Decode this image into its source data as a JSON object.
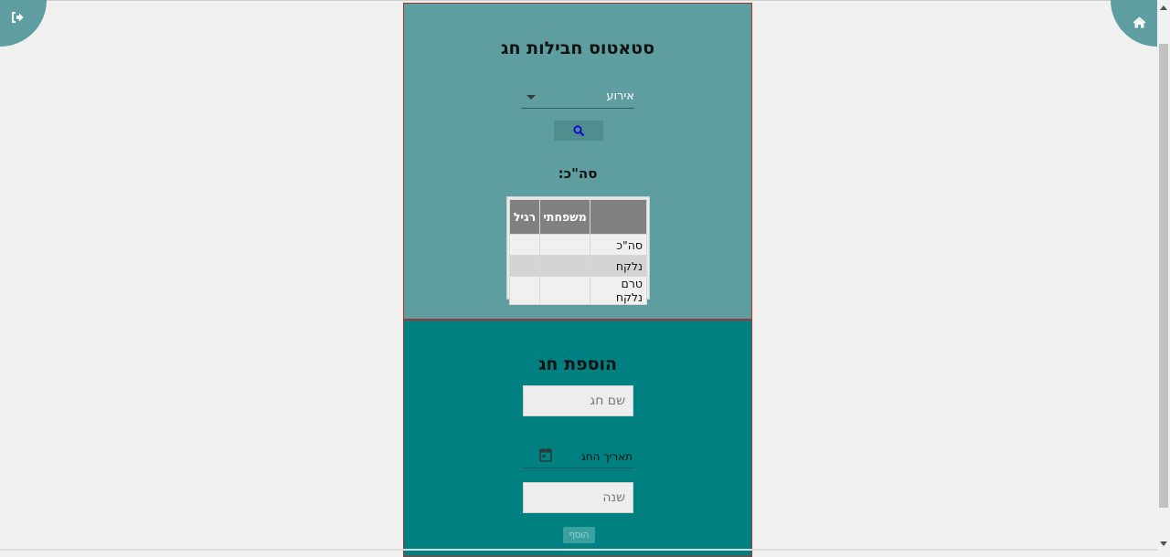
{
  "nav": {
    "logout_icon": "sign-out-icon",
    "home_icon": "home-icon"
  },
  "status_panel": {
    "title": "סטאטוס חבילות חג",
    "event_select": {
      "selected": "אירוע"
    },
    "search_icon": "search-icon",
    "total_label": "סה\"כ:",
    "table": {
      "headers": [
        "",
        "משפחתי",
        "רגיל"
      ],
      "rows": [
        {
          "label": "סה\"כ",
          "family": "",
          "regular": ""
        },
        {
          "label": "נלקח",
          "family": "",
          "regular": ""
        },
        {
          "label": "טרם נלקח",
          "family": "",
          "regular": ""
        }
      ]
    }
  },
  "add_panel": {
    "title": "הוספת חג",
    "name_placeholder": "שם חג",
    "date_label": "תאריך החג",
    "year_placeholder": "שנה",
    "add_label": "הוסף"
  },
  "colors": {
    "status_bg": "#5f9ea0",
    "add_bg": "#008080",
    "border": "#b03030",
    "header_bg": "#808080"
  }
}
